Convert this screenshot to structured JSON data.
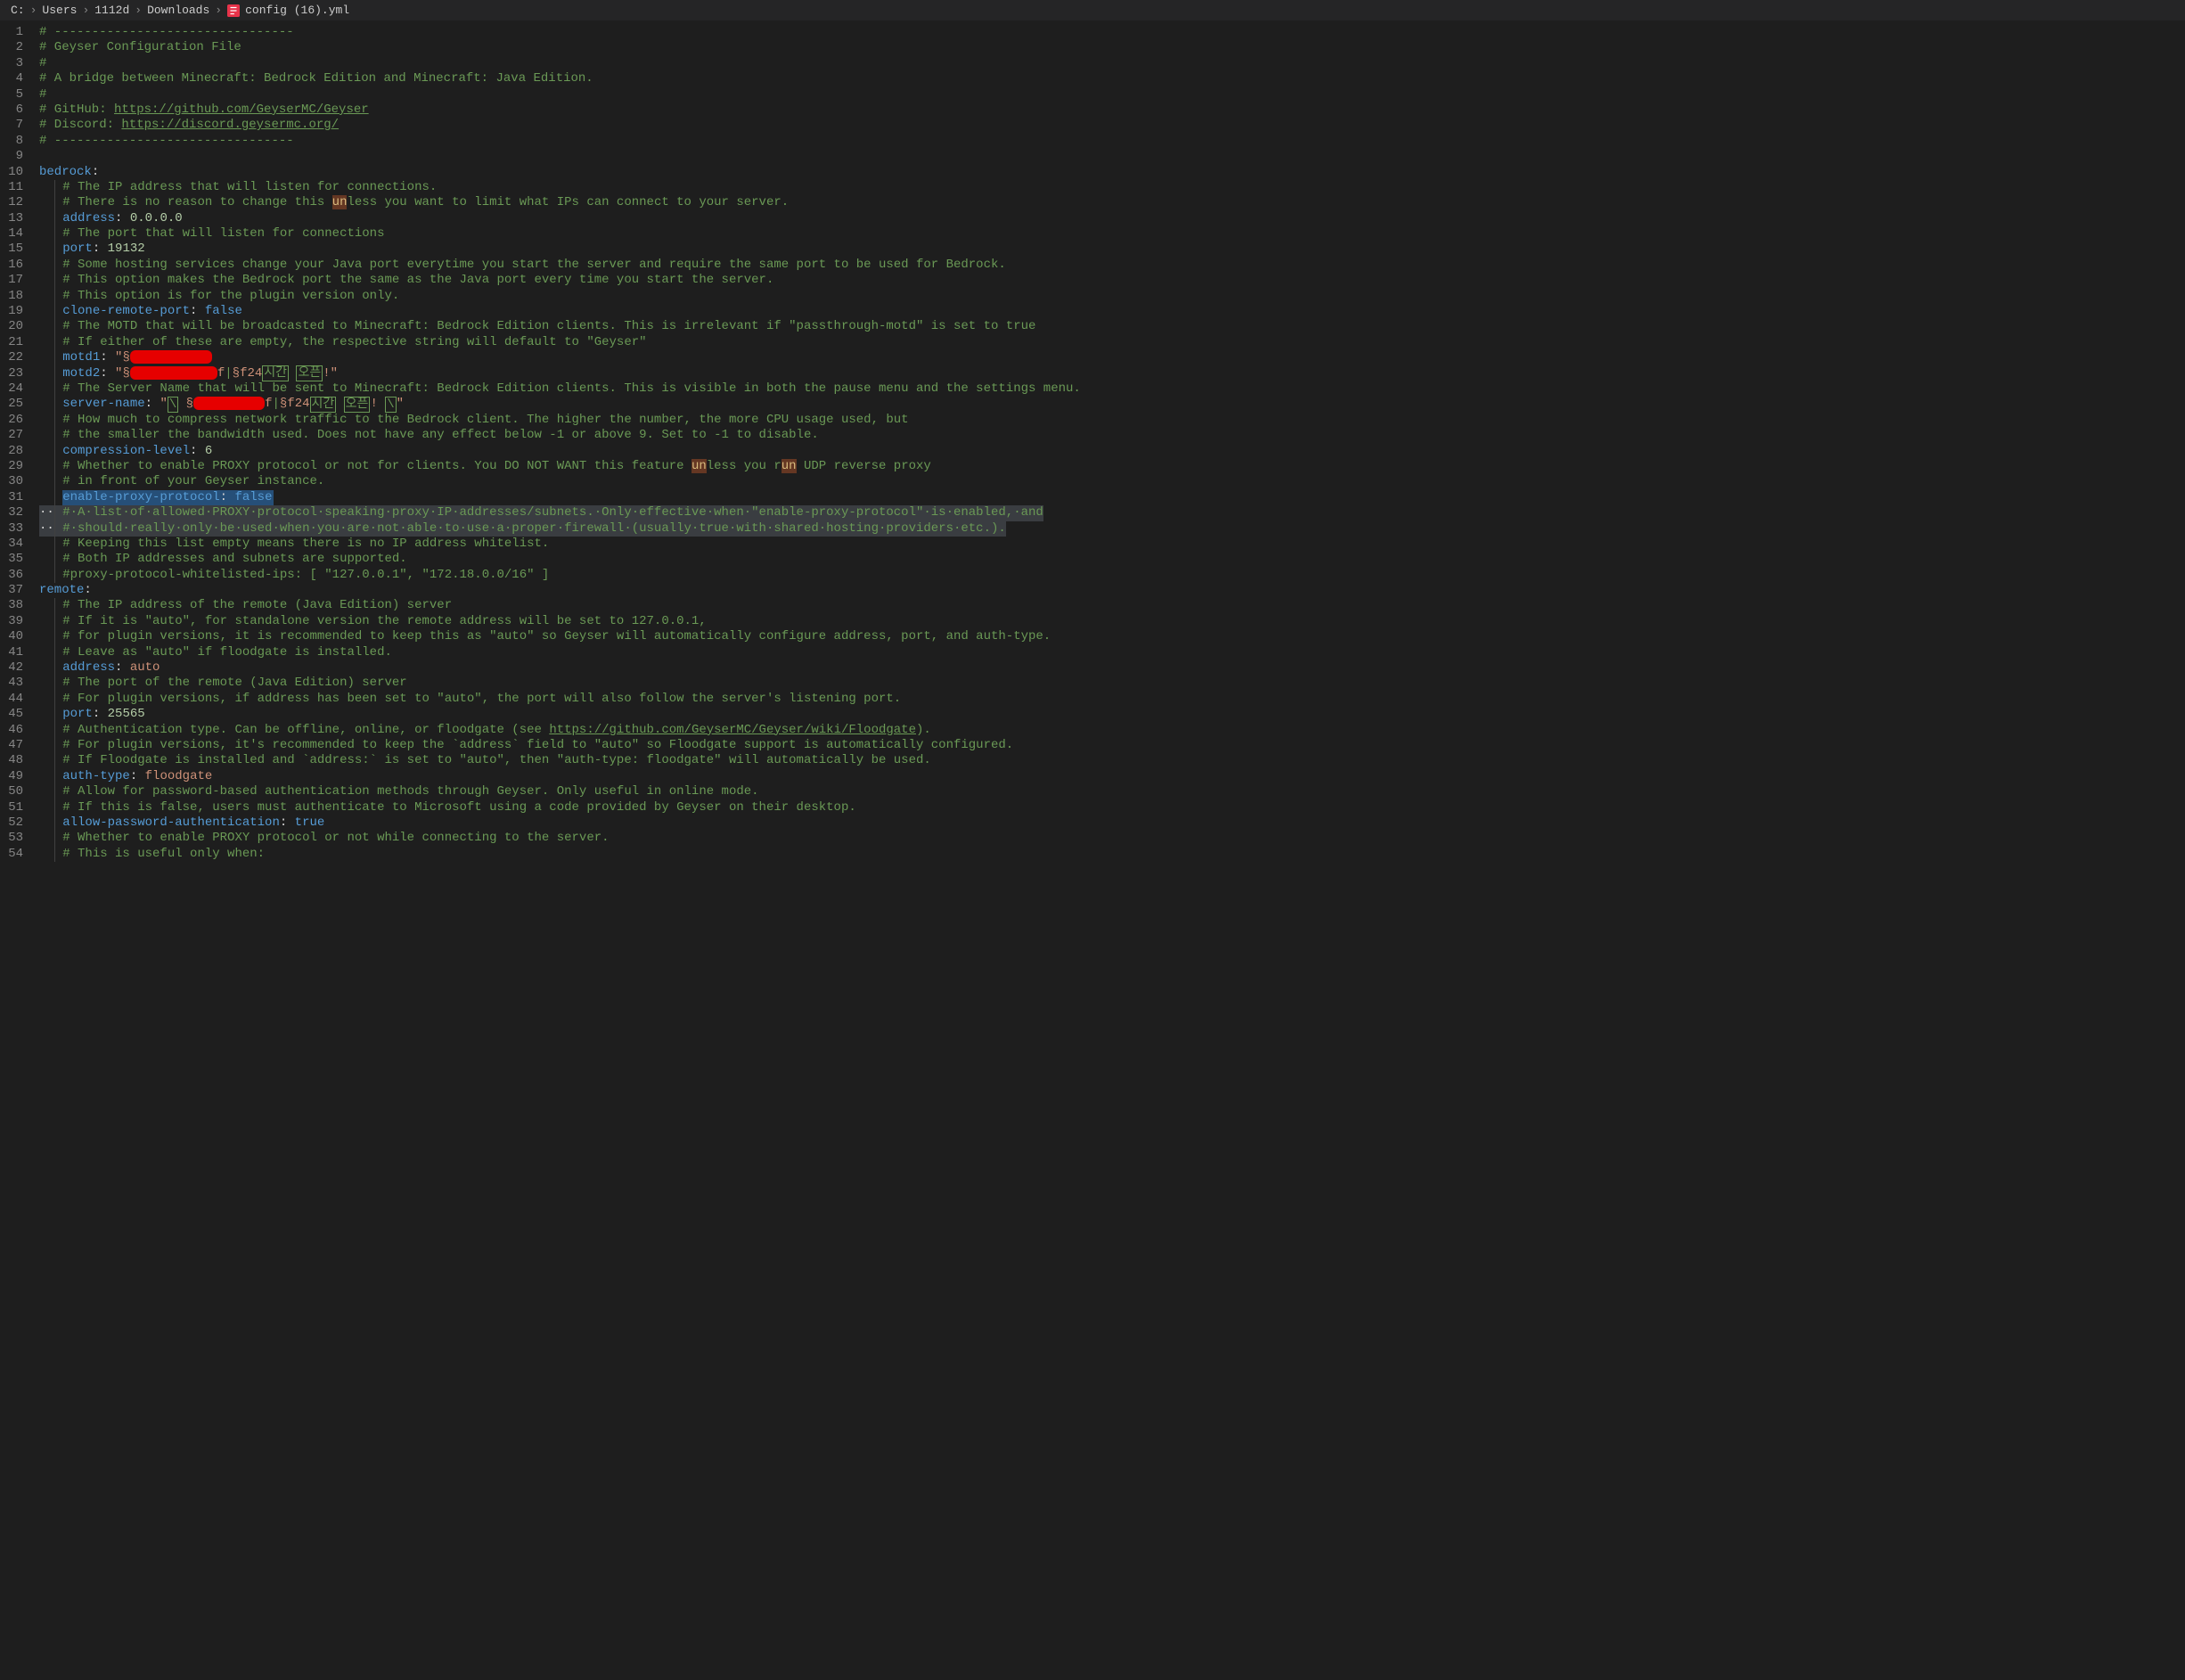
{
  "breadcrumb": [
    "C:",
    "Users",
    "1112d",
    "Downloads",
    "config (16).yml"
  ],
  "file_icon_color": "#e8334a",
  "lines": [
    {
      "n": 1,
      "t": "comment",
      "text": "# --------------------------------"
    },
    {
      "n": 2,
      "t": "comment",
      "text": "# Geyser Configuration File"
    },
    {
      "n": 3,
      "t": "comment",
      "text": "#"
    },
    {
      "n": 4,
      "t": "comment",
      "text": "# A bridge between Minecraft: Bedrock Edition and Minecraft: Java Edition."
    },
    {
      "n": 5,
      "t": "comment",
      "text": "#"
    },
    {
      "n": 6,
      "t": "url",
      "prefix": "# GitHub: ",
      "url": "https://github.com/GeyserMC/Geyser"
    },
    {
      "n": 7,
      "t": "url",
      "prefix": "# Discord: ",
      "url": "https://discord.geysermc.org/"
    },
    {
      "n": 8,
      "t": "comment",
      "text": "# --------------------------------"
    },
    {
      "n": 9,
      "t": "blank",
      "text": ""
    },
    {
      "n": 10,
      "t": "key",
      "key": "bedrock",
      "val": ""
    },
    {
      "n": 11,
      "t": "comment_i",
      "text": "# The IP address that will listen for connections."
    },
    {
      "n": 12,
      "t": "comment_hl",
      "pre": "# There is no reason to change this ",
      "hl": "un",
      "post": "less you want to limit what IPs can connect to your server."
    },
    {
      "n": 13,
      "t": "kv_i",
      "key": "address",
      "val": "0.0.0.0",
      "vt": "num"
    },
    {
      "n": 14,
      "t": "comment_i",
      "text": "# The port that will listen for connections"
    },
    {
      "n": 15,
      "t": "kv_i",
      "key": "port",
      "val": "19132",
      "vt": "num"
    },
    {
      "n": 16,
      "t": "comment_i",
      "text": "# Some hosting services change your Java port everytime you start the server and require the same port to be used for Bedrock."
    },
    {
      "n": 17,
      "t": "comment_i",
      "text": "# This option makes the Bedrock port the same as the Java port every time you start the server."
    },
    {
      "n": 18,
      "t": "comment_i",
      "text": "# This option is for the plugin version only."
    },
    {
      "n": 19,
      "t": "kv_i",
      "key": "clone-remote-port",
      "val": "false",
      "vt": "bool"
    },
    {
      "n": 20,
      "t": "comment_i",
      "text": "# The MOTD that will be broadcasted to Minecraft: Bedrock Edition clients. This is irrelevant if \"passthrough-motd\" is set to true"
    },
    {
      "n": 21,
      "t": "comment_i",
      "text": "# If either of these are empty, the respective string will default to \"Geyser\""
    },
    {
      "n": 22,
      "t": "motd1"
    },
    {
      "n": 23,
      "t": "motd2"
    },
    {
      "n": 24,
      "t": "comment_i",
      "text": "# The Server Name that will be sent to Minecraft: Bedrock Edition clients. This is visible in both the pause menu and the settings menu."
    },
    {
      "n": 25,
      "t": "servername"
    },
    {
      "n": 26,
      "t": "comment_i",
      "text": "# How much to compress network traffic to the Bedrock client. The higher the number, the more CPU usage used, but"
    },
    {
      "n": 27,
      "t": "comment_i",
      "text": "# the smaller the bandwidth used. Does not have any effect below -1 or above 9. Set to -1 to disable."
    },
    {
      "n": 28,
      "t": "kv_i",
      "key": "compression-level",
      "val": "6",
      "vt": "num"
    },
    {
      "n": 29,
      "t": "comment_hl2",
      "pre": "# Whether to enable PROXY protocol or not for clients. You DO NOT WANT this feature ",
      "hl1": "un",
      "mid": "less you r",
      "hl2": "un",
      "post": " UDP reverse proxy"
    },
    {
      "n": 30,
      "t": "comment_i",
      "text": "# in front of your Geyser instance."
    },
    {
      "n": 31,
      "t": "kv_sel",
      "key": "enable-proxy-protocol",
      "val": "false",
      "vt": "bool"
    },
    {
      "n": 32,
      "t": "sel_comment",
      "text": "# A list of allowed PROXY protocol speaking proxy IP addresses/subnets. Only effective when \"enable-proxy-protocol\" is enabled, and"
    },
    {
      "n": 33,
      "t": "sel_comment",
      "text": "# should really only be used when you are not able to use a proper firewall (usually true with shared hosting providers etc.)."
    },
    {
      "n": 34,
      "t": "comment_i",
      "text": "# Keeping this list empty means there is no IP address whitelist."
    },
    {
      "n": 35,
      "t": "comment_i",
      "text": "# Both IP addresses and subnets are supported."
    },
    {
      "n": 36,
      "t": "comment_i",
      "text": "#proxy-protocol-whitelisted-ips: [ \"127.0.0.1\", \"172.18.0.0/16\" ]"
    },
    {
      "n": 37,
      "t": "key",
      "key": "remote",
      "val": ""
    },
    {
      "n": 38,
      "t": "comment_i",
      "text": "# The IP address of the remote (Java Edition) server"
    },
    {
      "n": 39,
      "t": "comment_i",
      "text": "# If it is \"auto\", for standalone version the remote address will be set to 127.0.0.1,"
    },
    {
      "n": 40,
      "t": "comment_i",
      "text": "# for plugin versions, it is recommended to keep this as \"auto\" so Geyser will automatically configure address, port, and auth-type."
    },
    {
      "n": 41,
      "t": "comment_i",
      "text": "# Leave as \"auto\" if floodgate is installed."
    },
    {
      "n": 42,
      "t": "kv_i",
      "key": "address",
      "val": "auto",
      "vt": "str"
    },
    {
      "n": 43,
      "t": "comment_i",
      "text": "# The port of the remote (Java Edition) server"
    },
    {
      "n": 44,
      "t": "comment_i",
      "text": "# For plugin versions, if address has been set to \"auto\", the port will also follow the server's listening port."
    },
    {
      "n": 45,
      "t": "kv_i",
      "key": "port",
      "val": "25565",
      "vt": "num"
    },
    {
      "n": 46,
      "t": "comment_url",
      "pre": "# Authentication type. Can be offline, online, or floodgate (see ",
      "url": "https://github.com/GeyserMC/Geyser/wiki/Floodgate",
      "post": ")."
    },
    {
      "n": 47,
      "t": "comment_i",
      "text": "# For plugin versions, it's recommended to keep the `address` field to \"auto\" so Floodgate support is automatically configured."
    },
    {
      "n": 48,
      "t": "comment_i",
      "text": "# If Floodgate is installed and `address:` is set to \"auto\", then \"auth-type: floodgate\" will automatically be used."
    },
    {
      "n": 49,
      "t": "kv_i",
      "key": "auth-type",
      "val": "floodgate",
      "vt": "str"
    },
    {
      "n": 50,
      "t": "comment_i",
      "text": "# Allow for password-based authentication methods through Geyser. Only useful in online mode."
    },
    {
      "n": 51,
      "t": "comment_i",
      "text": "# If this is false, users must authenticate to Microsoft using a code provided by Geyser on their desktop."
    },
    {
      "n": 52,
      "t": "kv_i",
      "key": "allow-password-authentication",
      "val": "true",
      "vt": "bool"
    },
    {
      "n": 53,
      "t": "comment_i",
      "text": "# Whether to enable PROXY protocol or not while connecting to the server."
    },
    {
      "n": 54,
      "t": "comment_i",
      "text": "# This is useful only when:"
    }
  ],
  "redacted_strings": {
    "motd2_visible": "f|§f24시간 오픈!\"",
    "servername_visible_left": "\"\\ §",
    "servername_visible_right": "f|§f24시간 오픈! \\\""
  }
}
